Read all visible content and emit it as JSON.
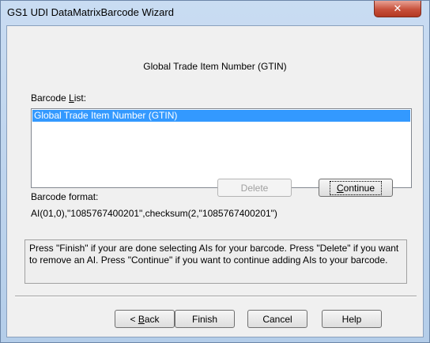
{
  "window": {
    "title": "GS1 UDI DataMatrixBarcode Wizard",
    "close_symbol": "✕"
  },
  "header": {
    "title": "Global Trade Item Number (GTIN)"
  },
  "barcode_list": {
    "label_prefix": "Barcode ",
    "label_mnemonic": "L",
    "label_suffix": "ist:",
    "items": [
      "Global Trade Item Number (GTIN)"
    ],
    "selected_index": 0
  },
  "buttons": {
    "delete": "Delete",
    "continue_mnemonic": "C",
    "continue_rest": "ontinue",
    "back_prefix": "< ",
    "back_mnemonic": "B",
    "back_rest": "ack",
    "finish": "Finish",
    "cancel": "Cancel",
    "help": "Help"
  },
  "format": {
    "label": "Barcode format:",
    "value": "AI(01,0),\"1085767400201\",checksum(2,\"1085767400201\")"
  },
  "message": "Press \"Finish\" if your are done selecting AIs for your barcode. Press \"Delete\" if you want to remove an AI. Press \"Continue\" if you want to continue adding AIs to your barcode.",
  "colors": {
    "selection": "#3399ff",
    "close_button": "#c7503b",
    "frame": "#b4cde9"
  }
}
